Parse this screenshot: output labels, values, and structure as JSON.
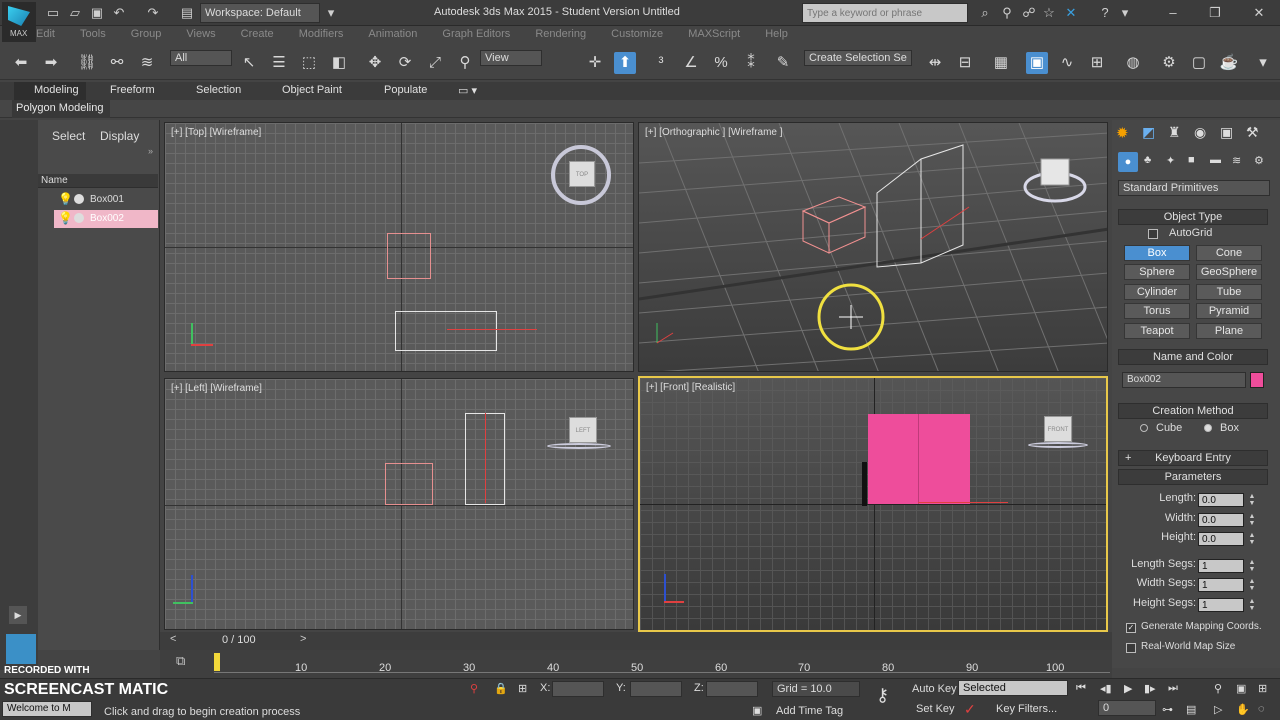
{
  "titlebar": {
    "app_logo_text": "MAX",
    "workspace": "Workspace: Default",
    "title": "Autodesk 3ds Max  2015  - Student Version   Untitled",
    "search_placeholder": "Type a keyword or phrase"
  },
  "menu": [
    "Edit",
    "Tools",
    "Group",
    "Views",
    "Create",
    "Modifiers",
    "Animation",
    "Graph Editors",
    "Rendering",
    "Customize",
    "MAXScript",
    "Help"
  ],
  "toolbar": {
    "selection_filter": "All",
    "reference_coord": "View",
    "create_selection_set": "Create Selection Se"
  },
  "ribbon": {
    "tabs": [
      "Modeling",
      "Freeform",
      "Selection",
      "Object Paint",
      "Populate"
    ],
    "panel_label": "Polygon Modeling"
  },
  "scene_explorer": {
    "tabs": [
      "Select",
      "Display"
    ],
    "column_header": "Name",
    "items": [
      "Box001",
      "Box002"
    ]
  },
  "viewports": [
    {
      "label": "[+] [Top] [Wireframe]",
      "cube": "TOP"
    },
    {
      "label": "[+] [Orthographic ] [Wireframe ]",
      "cube": ""
    },
    {
      "label": "[+] [Left] [Wireframe]",
      "cube": "LEFT"
    },
    {
      "label": "[+] [Front] [Realistic]",
      "cube": "FRONT"
    }
  ],
  "command_panel": {
    "category": "Standard Primitives",
    "object_type": {
      "header": "Object Type",
      "autogrid": "AutoGrid",
      "buttons": [
        "Box",
        "Cone",
        "Sphere",
        "GeoSphere",
        "Cylinder",
        "Tube",
        "Torus",
        "Pyramid",
        "Teapot",
        "Plane"
      ]
    },
    "name_and_color": {
      "header": "Name and Color",
      "name": "Box002",
      "color": "#ee4d9b"
    },
    "creation_method": {
      "header": "Creation Method",
      "options": [
        "Cube",
        "Box"
      ],
      "selected": "Box"
    },
    "keyboard_entry": {
      "header": "Keyboard Entry",
      "prefix": "+"
    },
    "parameters": {
      "header": "Parameters",
      "rows": [
        {
          "label": "Length:",
          "value": "0.0"
        },
        {
          "label": "Width:",
          "value": "0.0"
        },
        {
          "label": "Height:",
          "value": "0.0"
        },
        {
          "label": "Length Segs:",
          "value": "1"
        },
        {
          "label": "Width Segs:",
          "value": "1"
        },
        {
          "label": "Height Segs:",
          "value": "1"
        }
      ],
      "gen_mapping": "Generate Mapping Coords.",
      "real_world": "Real-World Map Size"
    }
  },
  "timeline": {
    "frame_display": "0 / 100",
    "ticks": [
      "10",
      "20",
      "30",
      "40",
      "50",
      "60",
      "70",
      "80",
      "90",
      "100"
    ]
  },
  "status": {
    "prompt": "Click and drag to begin creation process",
    "script_prompt": "Welcome to M",
    "x_label": "X:",
    "y_label": "Y:",
    "z_label": "Z:",
    "grid": "Grid = 10.0",
    "add_time_tag": "Add Time Tag",
    "auto_key": "Auto Key",
    "set_key": "Set Key",
    "key_mode": "Selected",
    "key_filters": "Key Filters...",
    "frame_field": "0",
    "watermark_top": "RECORDED WITH",
    "watermark_main": "SCREENCAST  MATIC"
  },
  "colors": {
    "accent": "#4a8fd0",
    "box_color": "#ee4d9b",
    "active_viewport": "#e8c84a",
    "wire_red": "#e04040"
  }
}
